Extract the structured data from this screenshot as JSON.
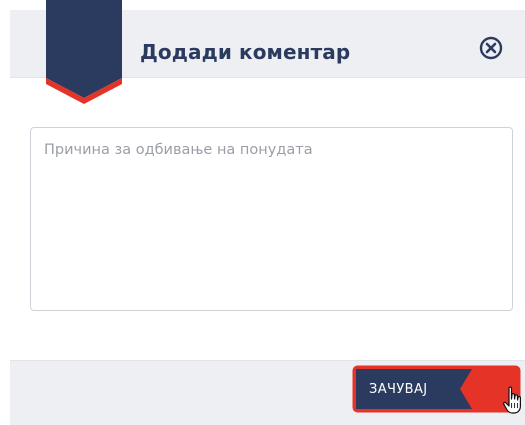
{
  "dialog": {
    "title": "Додади коментар",
    "close_icon": "close-circle-x-icon"
  },
  "comment": {
    "value": "",
    "placeholder": "Причина за одбивање на понудата"
  },
  "footer": {
    "save_label": "ЗАЧУВАЈ"
  },
  "colors": {
    "navy": "#2b3a5f",
    "red_accent": "#e63327",
    "panel_bg": "#eeeff3"
  }
}
